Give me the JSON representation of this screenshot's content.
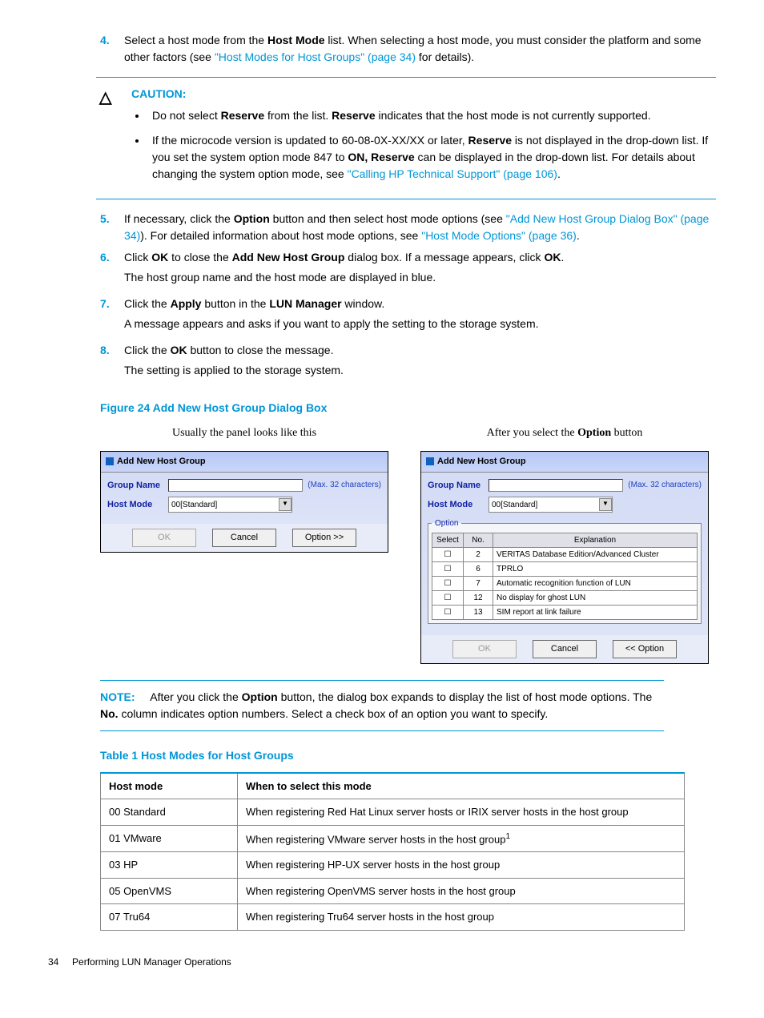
{
  "steps": {
    "s4": {
      "num": "4.",
      "text_a": "Select a host mode from the ",
      "bold_a": "Host Mode",
      "text_b": " list. When selecting a host mode, you must consider the platform and some other factors (see ",
      "link_a": "\"Host Modes for Host Groups\" (page 34)",
      "text_c": " for details)."
    },
    "s5": {
      "num": "5.",
      "text_a": "If necessary, click the ",
      "bold_a": "Option",
      "text_b": " button and then select host mode options (see ",
      "link_a": "\"Add New Host Group Dialog Box\" (page 34)",
      "text_c": "). For detailed information about host mode options, see ",
      "link_b": "\"Host Mode Options\" (page 36)",
      "text_d": "."
    },
    "s6": {
      "num": "6.",
      "text_a": "Click ",
      "bold_a": "OK",
      "text_b": " to close the ",
      "bold_b": "Add New Host Group",
      "text_c": " dialog box. If a message appears, click ",
      "bold_c": "OK",
      "text_d": ".",
      "p2": "The host group name and the host mode are displayed in blue."
    },
    "s7": {
      "num": "7.",
      "text_a": "Click the ",
      "bold_a": "Apply",
      "text_b": " button in the ",
      "bold_b": "LUN Manager",
      "text_c": " window.",
      "p2": "A message appears and asks if you want to apply the setting to the storage system."
    },
    "s8": {
      "num": "8.",
      "text_a": "Click the ",
      "bold_a": "OK",
      "text_b": " button to close the message.",
      "p2": "The setting is applied to the storage system."
    }
  },
  "caution": {
    "heading": "CAUTION:",
    "b1_a": "Do not select ",
    "b1_bold_a": "Reserve",
    "b1_b": " from the list. ",
    "b1_bold_b": "Reserve",
    "b1_c": " indicates that the host mode is not currently supported.",
    "b2_a": "If the microcode version is updated to 60-08-0X-XX/XX or later, ",
    "b2_bold_a": "Reserve",
    "b2_b": " is not displayed in the drop-down list. If you set the system option mode 847 to ",
    "b2_bold_b": "ON, Reserve",
    "b2_c": " can be displayed in the drop-down list. For details about changing the system option mode, see ",
    "b2_link": "\"Calling HP Technical Support\" (page 106)",
    "b2_d": "."
  },
  "figure": {
    "caption": "Figure 24 Add New Host Group Dialog Box",
    "left_header": "Usually the panel looks like this",
    "right_header_a": "After you select the ",
    "right_header_bold": "Option",
    "right_header_b": " button",
    "panel_title": "Add New Host Group",
    "group_name_label": "Group Name",
    "host_mode_label": "Host Mode",
    "max_chars": "(Max. 32 characters)",
    "host_mode_value": "00[Standard]",
    "btn_ok": "OK",
    "btn_cancel": "Cancel",
    "btn_option_open": "Option >>",
    "btn_option_close": "<< Option",
    "option_legend": "Option",
    "th_select": "Select",
    "th_no": "No.",
    "th_explanation": "Explanation",
    "rows": [
      {
        "no": "2",
        "exp": "VERITAS Database Edition/Advanced Cluster"
      },
      {
        "no": "6",
        "exp": "TPRLO"
      },
      {
        "no": "7",
        "exp": "Automatic recognition function of LUN"
      },
      {
        "no": "12",
        "exp": "No display for ghost LUN"
      },
      {
        "no": "13",
        "exp": "SIM report at link failure"
      }
    ]
  },
  "note": {
    "heading": "NOTE:",
    "text_a": "After you click the ",
    "bold_a": "Option",
    "text_b": " button, the dialog box expands to display the list of host mode options. The ",
    "bold_b": "No.",
    "text_c": " column indicates option numbers. Select a check box of an option you want to specify."
  },
  "table1": {
    "caption": "Table 1 Host Modes for Host Groups",
    "th_mode": "Host mode",
    "th_when": "When to select this mode",
    "rows": [
      {
        "mode": "00 Standard",
        "when": "When registering Red Hat Linux server hosts or IRIX server hosts in the host group"
      },
      {
        "mode": "01 VMware",
        "when_a": "When registering VMware server hosts in the host group",
        "sup": "1"
      },
      {
        "mode": "03 HP",
        "when": "When registering HP-UX server hosts in the host group"
      },
      {
        "mode": "05 OpenVMS",
        "when": "When registering OpenVMS server hosts in the host group"
      },
      {
        "mode": "07 Tru64",
        "when": "When registering Tru64 server hosts in the host group"
      }
    ]
  },
  "footer": {
    "page": "34",
    "title": "Performing LUN Manager Operations"
  }
}
